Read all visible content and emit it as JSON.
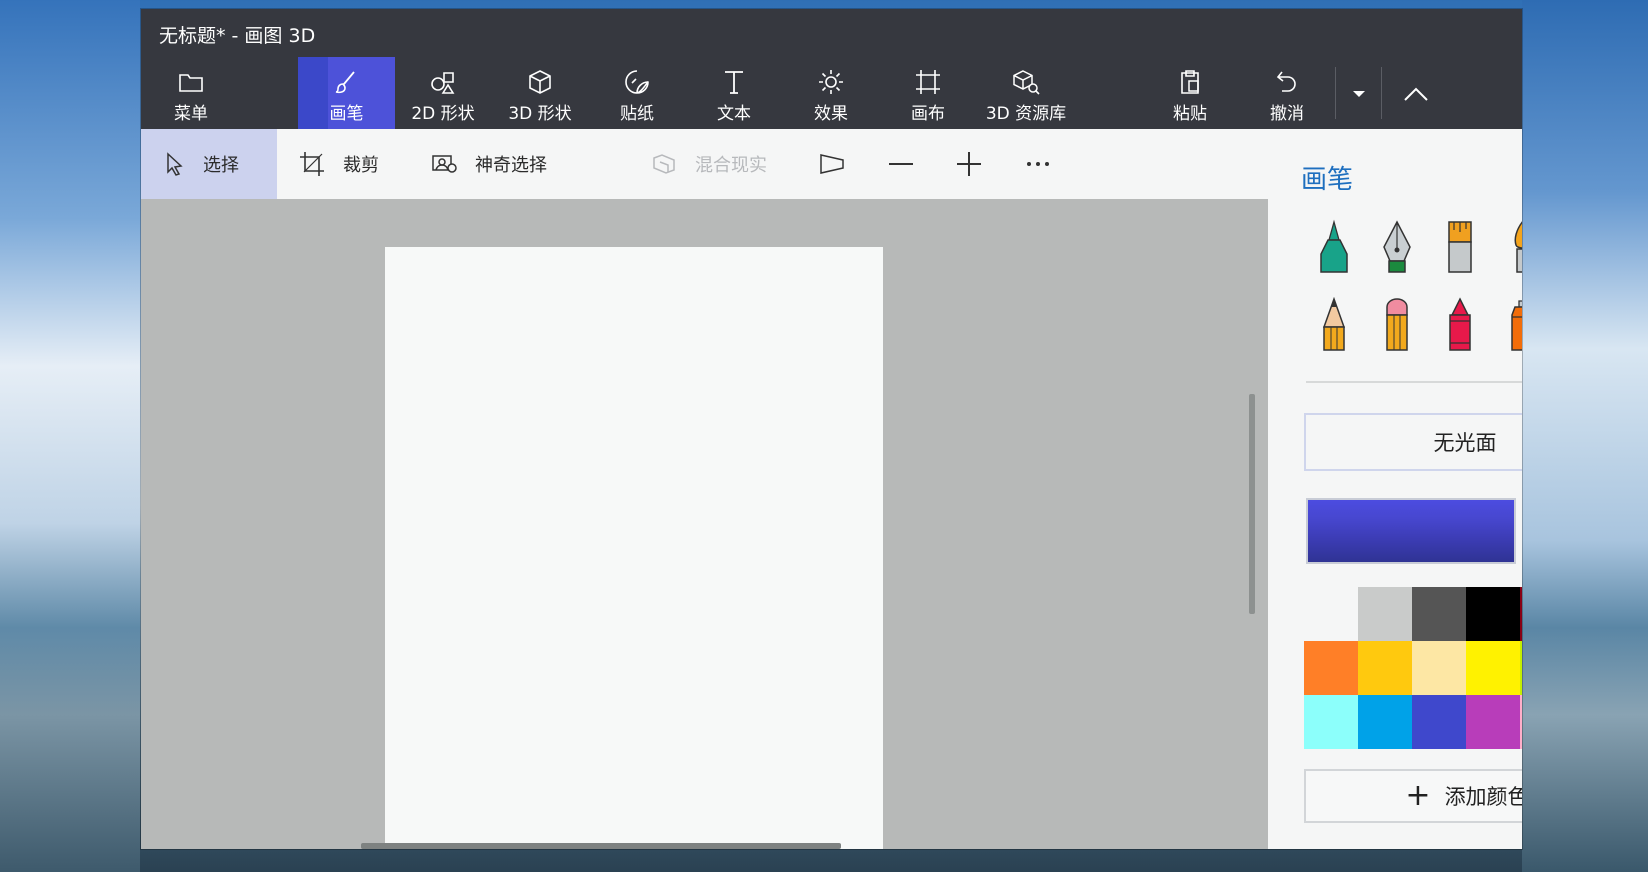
{
  "window": {
    "title": "无标题* - 画图 3D"
  },
  "ribbon": {
    "menu": "菜单",
    "brushes": "画笔",
    "shapes2d": "2D 形状",
    "shapes3d": "3D 形状",
    "stickers": "贴纸",
    "text": "文本",
    "effects": "效果",
    "canvas": "画布",
    "library3d": "3D 资源库",
    "paste": "粘贴",
    "undo": "撤消",
    "active_color": "#4d52d9"
  },
  "toolbar": {
    "select": "选择",
    "crop": "裁剪",
    "magic_select": "神奇选择",
    "mixed_reality": "混合现实"
  },
  "panel": {
    "title": "画笔",
    "brushes": [
      "marker-icon",
      "calligraphy-pen-icon",
      "oil-brush-icon",
      "watercolor-icon",
      "pixel-pen-icon",
      "pencil-icon",
      "eraser-icon",
      "crayon-icon",
      "spray-can-icon",
      "fill-bucket-icon"
    ],
    "material": "无光面",
    "current_color": "#4747cf",
    "palette": [
      "#f5f6f6",
      "#c9cbca",
      "#555555",
      "#000000",
      "#880015",
      "#ed1c24",
      "#ff7f27",
      "#ffc90e",
      "#fde7a4",
      "#fff200",
      "#c4f000",
      "#0ecf46",
      "#8cfffb",
      "#00a2e8",
      "#3f48cc",
      "#b83dba",
      "#ffaec9",
      "#b97a57"
    ],
    "add_color": "添加颜色"
  }
}
